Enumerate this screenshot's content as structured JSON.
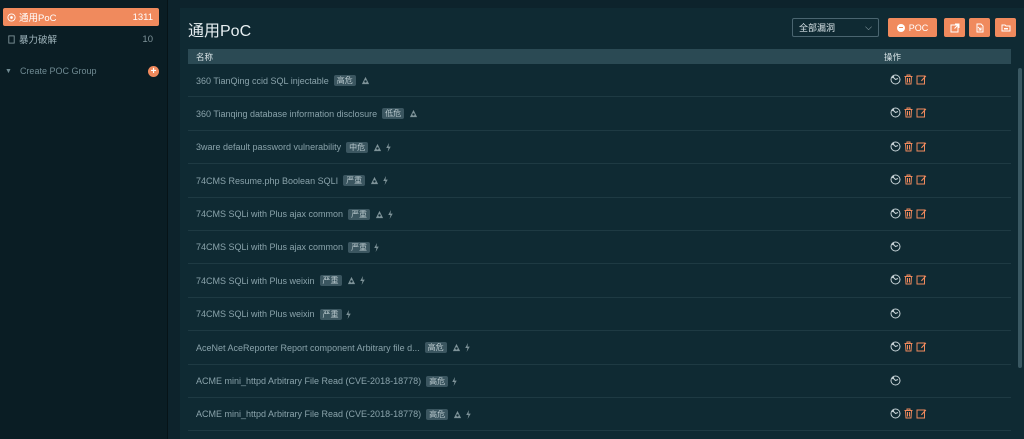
{
  "sidebar": {
    "items": [
      {
        "label": "通用PoC",
        "count": "1311",
        "active": true
      },
      {
        "label": "暴力破解",
        "count": "10",
        "active": false
      }
    ],
    "group": {
      "label": "Create POC Group"
    }
  },
  "main": {
    "title": "通用PoC",
    "filter": {
      "selected": "全部漏洞"
    },
    "toolbar": {
      "poc_label": "POC"
    },
    "table": {
      "headers": {
        "name": "名称",
        "actions": "操作"
      },
      "rows": [
        {
          "name": "360 TianQing ccid SQL injectable",
          "badge": "高危",
          "mark": true,
          "bolt": false,
          "editable": true
        },
        {
          "name": "360 Tianqing database information disclosure",
          "badge": "低危",
          "mark": true,
          "bolt": false,
          "editable": true
        },
        {
          "name": "3ware default password vulnerability",
          "badge": "中危",
          "mark": true,
          "bolt": true,
          "editable": true
        },
        {
          "name": "74CMS Resume.php Boolean SQLI",
          "badge": "严重",
          "mark": true,
          "bolt": true,
          "editable": true
        },
        {
          "name": "74CMS SQLi with Plus ajax common",
          "badge": "严重",
          "mark": true,
          "bolt": true,
          "editable": true
        },
        {
          "name": "74CMS SQLi with Plus ajax common",
          "badge": "严重",
          "mark": false,
          "bolt": true,
          "editable": false
        },
        {
          "name": "74CMS SQLi with Plus weixin",
          "badge": "严重",
          "mark": true,
          "bolt": true,
          "editable": true
        },
        {
          "name": "74CMS SQLi with Plus weixin",
          "badge": "严重",
          "mark": false,
          "bolt": true,
          "editable": false
        },
        {
          "name": "AceNet AceReporter Report component Arbitrary file d...",
          "badge": "高危",
          "mark": true,
          "bolt": true,
          "editable": true
        },
        {
          "name": "ACME mini_httpd Arbitrary File Read (CVE-2018-18778)",
          "badge": "高危",
          "mark": false,
          "bolt": true,
          "editable": false
        },
        {
          "name": "ACME mini_httpd Arbitrary File Read (CVE-2018-18778)",
          "badge": "高危",
          "mark": true,
          "bolt": true,
          "editable": true
        }
      ]
    }
  },
  "colors": {
    "accent": "#f08a5d",
    "bg": "#0f2a33",
    "sidebar": "#0a1d24"
  }
}
